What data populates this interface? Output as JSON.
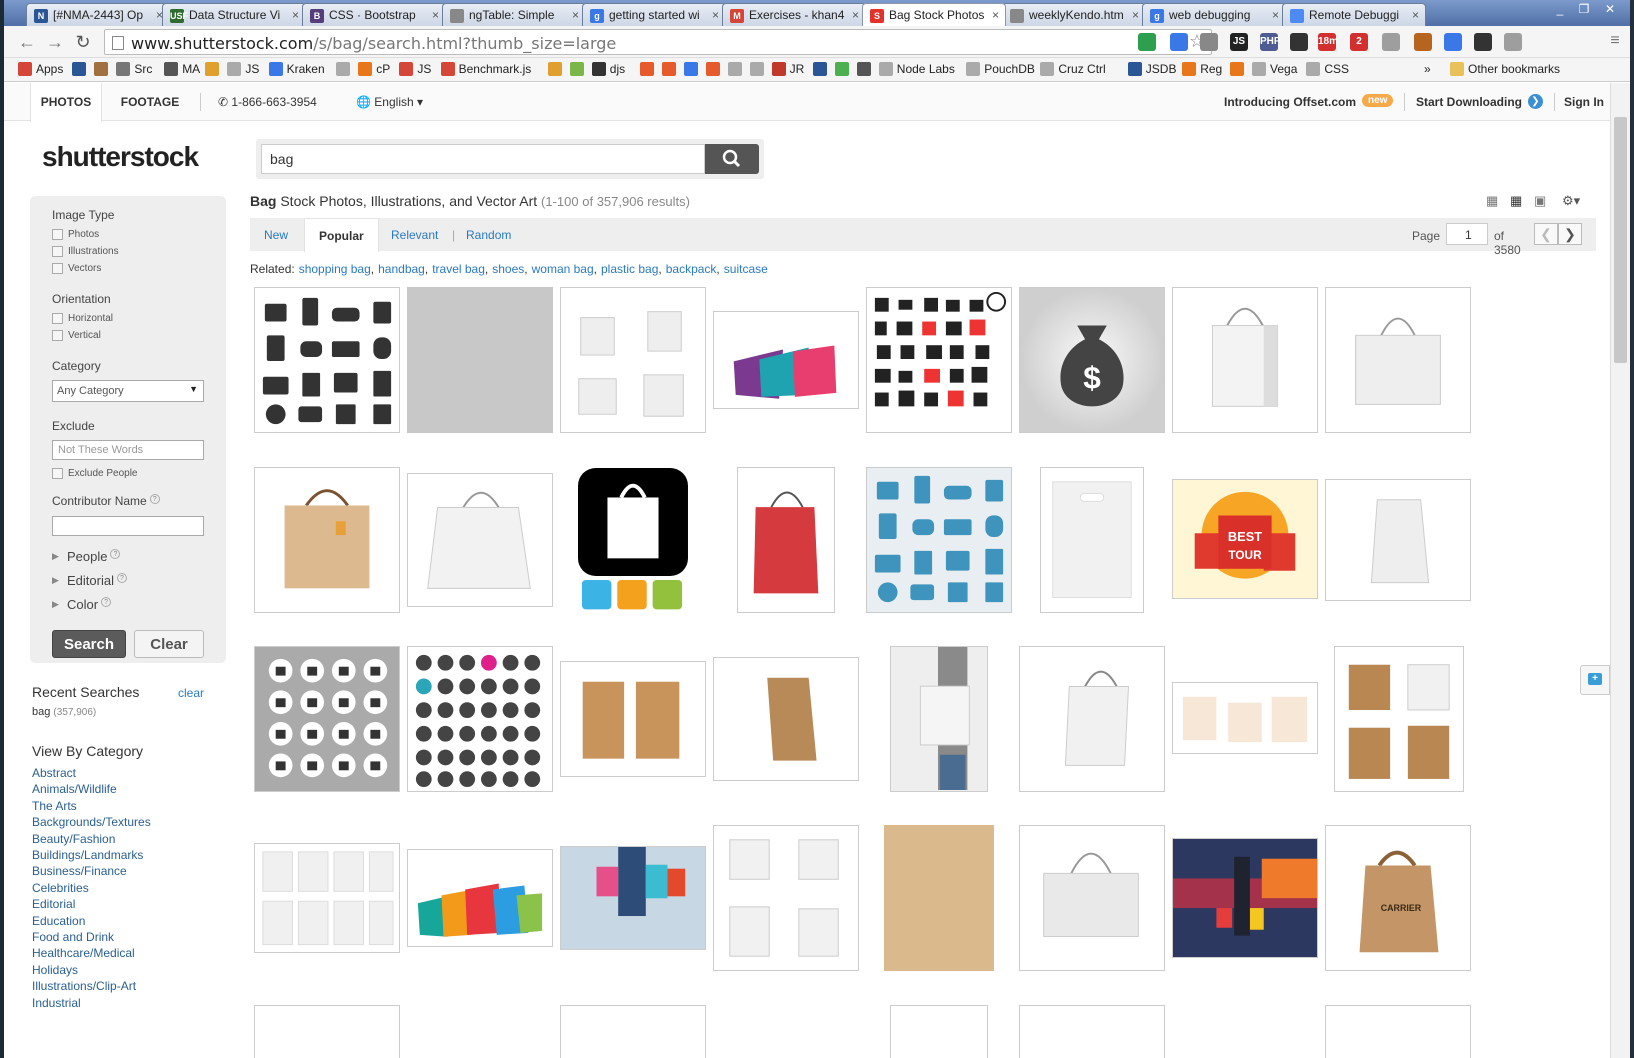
{
  "browser": {
    "tabs": [
      {
        "label": "[#NMA-2443] Op",
        "fav": "N",
        "color": "#2a5696"
      },
      {
        "label": "Data Structure Vi",
        "fav": "USF",
        "color": "#2e6b2e"
      },
      {
        "label": "CSS · Bootstrap",
        "fav": "B",
        "color": "#563d7c"
      },
      {
        "label": "ngTable: Simple",
        "fav": "",
        "color": "#888888"
      },
      {
        "label": "getting started wi",
        "fav": "g",
        "color": "#3b78e7"
      },
      {
        "label": "Exercises - khan4",
        "fav": "M",
        "color": "#d44638"
      },
      {
        "label": "Bag Stock Photos",
        "fav": "S",
        "color": "#e4322b"
      },
      {
        "label": "weeklyKendo.htm",
        "fav": "",
        "color": "#888888"
      },
      {
        "label": "web debugging",
        "fav": "g",
        "color": "#3b78e7"
      },
      {
        "label": "Remote Debuggi",
        "fav": "",
        "color": "#4c8bf5"
      }
    ],
    "url_domain": "www.shutterstock.com",
    "url_path": "/s/bag/search.html?thumb_size=large",
    "bookmarks": [
      {
        "label": "Apps",
        "color": "#d44638"
      },
      {
        "label": "",
        "color": "#2a5696"
      },
      {
        "label": "",
        "color": "#a07040"
      },
      {
        "label": "Src",
        "color": "#777777"
      },
      {
        "label": "MA",
        "color": "#555555"
      },
      {
        "label": "",
        "color": "#e0a030"
      },
      {
        "label": "JS",
        "color": "#aaaaaa"
      },
      {
        "label": "Kraken",
        "color": "#3b78e7"
      },
      {
        "label": "",
        "color": "#aaaaaa"
      },
      {
        "label": "cP",
        "color": "#e8761a"
      },
      {
        "label": "JS",
        "color": "#d44638"
      },
      {
        "label": "Benchmark.js",
        "color": "#d44638"
      },
      {
        "label": "",
        "color": "#e0a030"
      },
      {
        "label": "",
        "color": "#7ab648"
      },
      {
        "label": "djs",
        "color": "#333333"
      },
      {
        "label": "",
        "color": "#e65a2c"
      },
      {
        "label": "",
        "color": "#e65a2c"
      },
      {
        "label": "",
        "color": "#3b78e7"
      },
      {
        "label": "",
        "color": "#e65a2c"
      },
      {
        "label": "",
        "color": "#aaaaaa"
      },
      {
        "label": "",
        "color": "#aaaaaa"
      },
      {
        "label": "JR",
        "color": "#c0392b"
      },
      {
        "label": "",
        "color": "#2a5696"
      },
      {
        "label": "",
        "color": "#4caf50"
      },
      {
        "label": "",
        "color": "#555555"
      },
      {
        "label": "Node Labs",
        "color": "#aaaaaa"
      },
      {
        "label": "PouchDB",
        "color": "#aaaaaa"
      },
      {
        "label": "Cruz Ctrl",
        "color": "#aaaaaa"
      },
      {
        "label": "JSDB",
        "color": "#2a5696"
      },
      {
        "label": "Reg",
        "color": "#e8761a"
      },
      {
        "label": "",
        "color": "#e8761a"
      },
      {
        "label": "Vega",
        "color": "#aaaaaa"
      },
      {
        "label": "CSS",
        "color": "#aaaaaa"
      }
    ],
    "bookmarks_more": "»",
    "other_bookmarks": "Other bookmarks",
    "extensions": [
      {
        "t": "",
        "c": "#2e9e4f"
      },
      {
        "t": "",
        "c": "#3b78e7"
      },
      {
        "t": "",
        "c": "#888888"
      },
      {
        "t": "JS",
        "c": "#222222"
      },
      {
        "t": "PHP",
        "c": "#4f5b93"
      },
      {
        "t": "",
        "c": "#333333"
      },
      {
        "t": "18m",
        "c": "#d32f2f"
      },
      {
        "t": "2",
        "c": "#d32f2f"
      },
      {
        "t": "",
        "c": "#9e9e9e"
      },
      {
        "t": "",
        "c": "#b5651d"
      },
      {
        "t": "",
        "c": "#3b78e7"
      },
      {
        "t": "",
        "c": "#333333"
      },
      {
        "t": "",
        "c": "#9e9e9e"
      }
    ]
  },
  "site": {
    "nav": {
      "photos": "PHOTOS",
      "footage": "FOOTAGE",
      "phone": "1-866-663-3954",
      "language": "English ▾",
      "offset": "Introducing Offset.com",
      "new_badge": "new",
      "start_downloading": "Start Downloading",
      "sign_in": "Sign In"
    },
    "logo": "shutterstock",
    "search": {
      "value": "bag"
    }
  },
  "filters": {
    "image_type": {
      "heading": "Image Type",
      "options": [
        "Photos",
        "Illustrations",
        "Vectors"
      ]
    },
    "orientation": {
      "heading": "Orientation",
      "options": [
        "Horizontal",
        "Vertical"
      ]
    },
    "category": {
      "heading": "Category",
      "selected": "Any Category"
    },
    "exclude": {
      "heading": "Exclude",
      "placeholder": "Not These Words",
      "people_option": "Exclude People"
    },
    "contributor": {
      "heading": "Contributor Name",
      "value": ""
    },
    "expanders": [
      "People",
      "Editorial",
      "Color"
    ],
    "search_btn": "Search",
    "clear_btn": "Clear"
  },
  "recent": {
    "heading": "Recent Searches",
    "clear": "clear",
    "item": "bag",
    "item_count": "(357,906)"
  },
  "view_by_category": {
    "heading": "View By Category",
    "items": [
      "Abstract",
      "Animals/Wildlife",
      "The Arts",
      "Backgrounds/Textures",
      "Beauty/Fashion",
      "Buildings/Landmarks",
      "Business/Finance",
      "Celebrities",
      "Editorial",
      "Education",
      "Food and Drink",
      "Healthcare/Medical",
      "Holidays",
      "Illustrations/Clip-Art",
      "Industrial"
    ]
  },
  "results": {
    "title_bold": "Bag",
    "title_rest": " Stock Photos, Illustrations, and Vector Art",
    "count": "(1-100 of 357,906 results)",
    "sort_tabs": [
      "New",
      "Popular",
      "Relevant",
      "Random"
    ],
    "sort_sep": "|",
    "page_label": "Page",
    "page_value": "1",
    "page_of": "of 3580",
    "related_label": "Related:",
    "related": [
      "shopping bag",
      "handbag",
      "travel bag",
      "shoes",
      "woman bag",
      "plastic bag",
      "backpack",
      "suitcase"
    ]
  }
}
